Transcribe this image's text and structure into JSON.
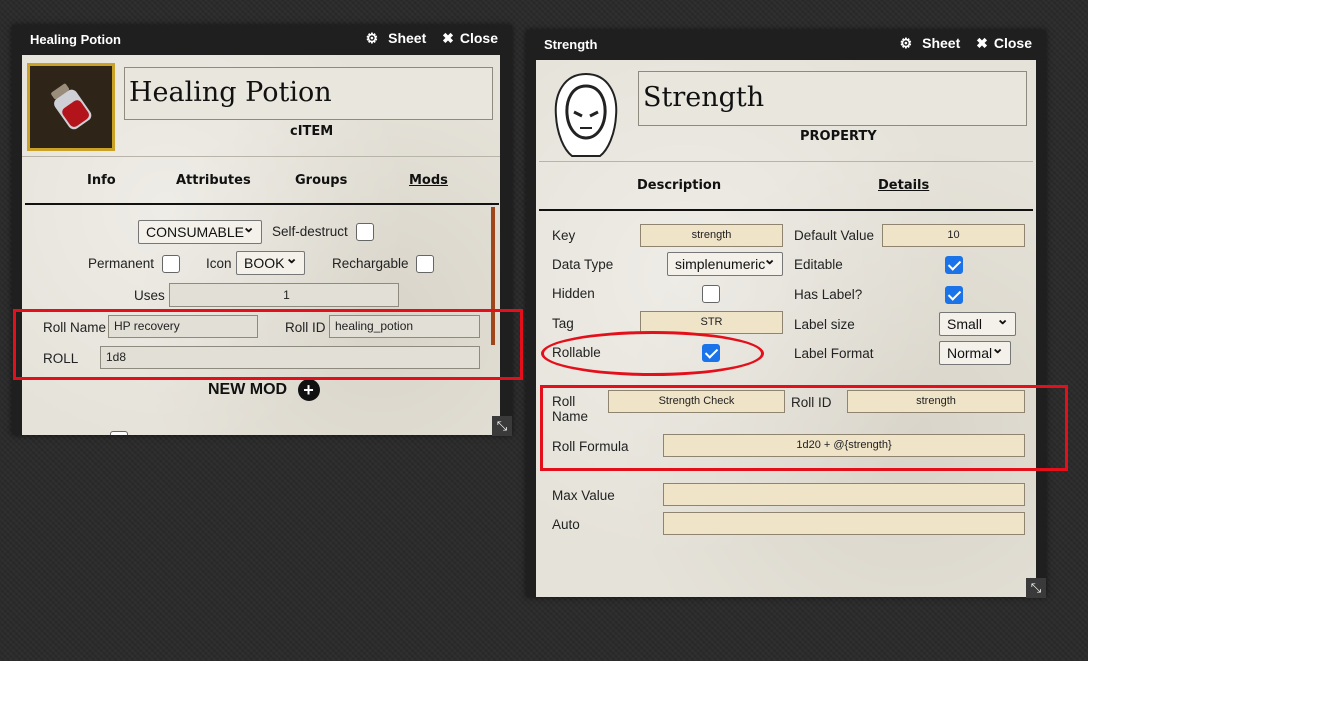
{
  "left_window": {
    "title": "Healing Potion",
    "sheet_label": "Sheet",
    "close_label": "Close",
    "name": "Healing Potion",
    "type_label": "cITEM",
    "tabs": [
      "Info",
      "Attributes",
      "Groups",
      "Mods"
    ],
    "consumable_value": "CONSUMABLE",
    "self_destruct_label": "Self-destruct",
    "permanent_label": "Permanent",
    "icon_label": "Icon",
    "icon_value": "BOOK",
    "rechargable_label": "Rechargable",
    "uses_label": "Uses",
    "uses_value": "1",
    "roll_name_label": "Roll Name",
    "roll_name_value": "HP recovery",
    "roll_id_label": "Roll ID",
    "roll_id_value": "healing_potion",
    "roll_label": "ROLL",
    "roll_value": "1d8",
    "new_mod_label": "NEW MOD"
  },
  "right_window": {
    "title": "Strength",
    "sheet_label": "Sheet",
    "close_label": "Close",
    "name": "Strength",
    "type_label": "PROPERTY",
    "tabs": [
      "Description",
      "Details"
    ],
    "key_label": "Key",
    "key_value": "strength",
    "default_value_label": "Default Value",
    "default_value": "10",
    "data_type_label": "Data Type",
    "data_type_value": "simplenumeric",
    "editable_label": "Editable",
    "hidden_label": "Hidden",
    "has_label_label": "Has Label?",
    "tag_label": "Tag",
    "tag_value": "STR",
    "label_size_label": "Label size",
    "label_size_value": "Small",
    "rollable_label": "Rollable",
    "label_format_label": "Label Format",
    "label_format_value": "Normal",
    "roll_name_label_1": "Roll",
    "roll_name_label_2": "Name",
    "roll_name_value": "Strength Check",
    "roll_id_label": "Roll ID",
    "roll_id_value": "strength",
    "roll_formula_label": "Roll Formula",
    "roll_formula_value": "1d20 + @{strength}",
    "max_value_label": "Max Value",
    "max_value": "",
    "auto_label": "Auto",
    "auto_value": ""
  },
  "colors": {
    "annotation": "#e3101b",
    "checkbox_checked": "#1a73e8",
    "field_tan": "#efe3c8"
  }
}
